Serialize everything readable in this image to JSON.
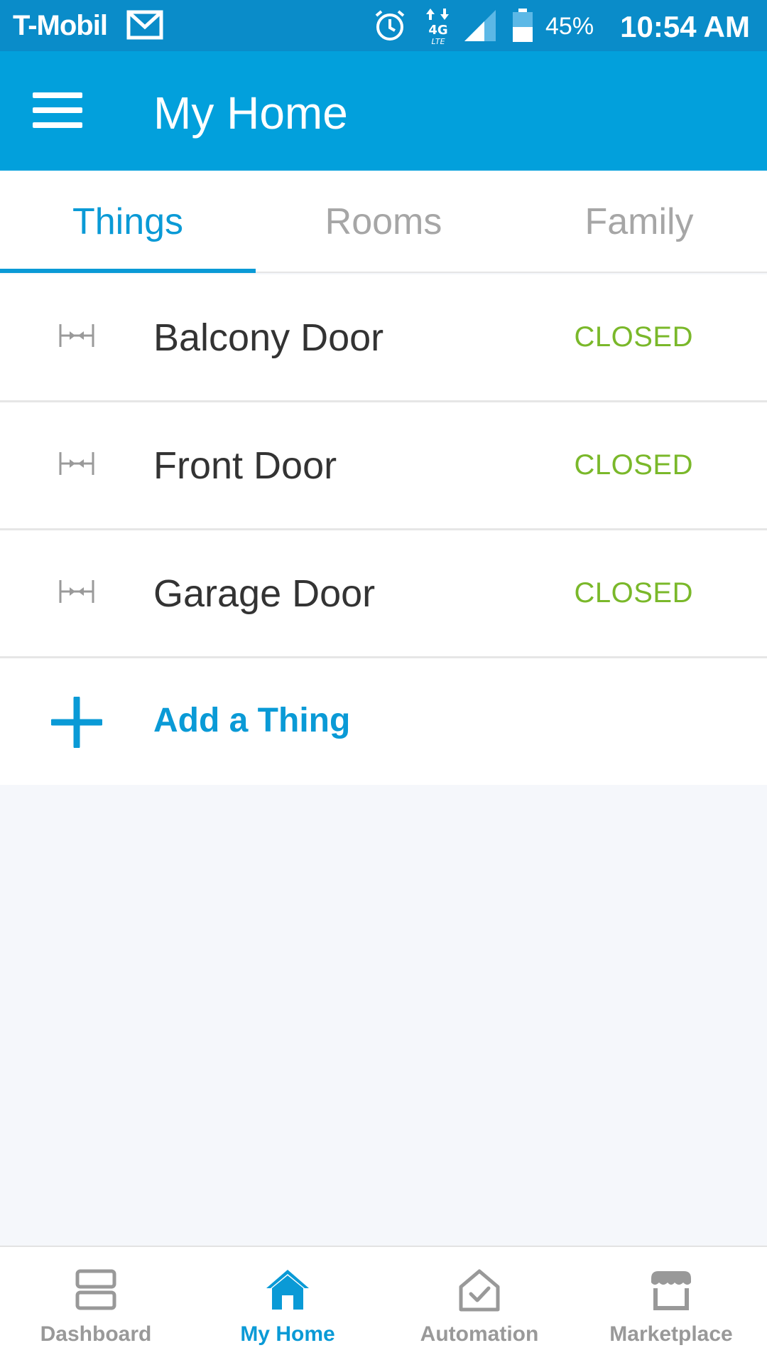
{
  "status_bar": {
    "carrier": "T-Mobil",
    "battery": "45%",
    "time": "10:54 AM",
    "icons": [
      "gmail-icon",
      "alarm-icon",
      "4g-lte-icon",
      "signal-icon",
      "battery-icon"
    ]
  },
  "app_bar": {
    "title": "My Home",
    "menu_icon": "hamburger-menu-icon"
  },
  "tabs": [
    {
      "label": "Things",
      "active": true
    },
    {
      "label": "Rooms",
      "active": false
    },
    {
      "label": "Family",
      "active": false
    }
  ],
  "things": [
    {
      "name": "Balcony Door",
      "status": "CLOSED",
      "icon": "door-sensor-icon"
    },
    {
      "name": "Front Door",
      "status": "CLOSED",
      "icon": "door-sensor-icon"
    },
    {
      "name": "Garage Door",
      "status": "CLOSED",
      "icon": "door-sensor-icon"
    }
  ],
  "add_thing": {
    "label": "Add a Thing",
    "icon": "plus-icon"
  },
  "bottom_nav": [
    {
      "label": "Dashboard",
      "icon": "dashboard-icon",
      "active": false
    },
    {
      "label": "My Home",
      "icon": "home-icon",
      "active": true
    },
    {
      "label": "Automation",
      "icon": "automation-icon",
      "active": false
    },
    {
      "label": "Marketplace",
      "icon": "marketplace-icon",
      "active": false
    }
  ],
  "colors": {
    "status_bar": "#0a8cc9",
    "app_bar": "#02a0dc",
    "accent": "#0a9ad6",
    "closed_status": "#7ab82a",
    "inactive": "#999999"
  }
}
